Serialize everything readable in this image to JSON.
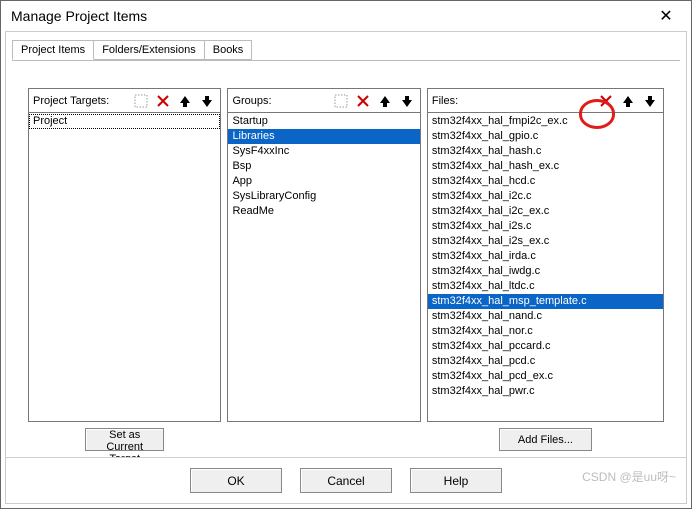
{
  "window": {
    "title": "Manage Project Items"
  },
  "tabs": [
    {
      "label": "Project Items",
      "active": true
    },
    {
      "label": "Folders/Extensions",
      "active": false
    },
    {
      "label": "Books",
      "active": false
    }
  ],
  "columns": {
    "targets": {
      "label": "Project Targets:",
      "items": [
        {
          "label": "Project",
          "selected": false,
          "focus": true
        }
      ],
      "button": "Set as Current Target",
      "icons": [
        "new-icon",
        "delete-icon",
        "move-up-icon",
        "move-down-icon"
      ]
    },
    "groups": {
      "label": "Groups:",
      "items": [
        {
          "label": "Startup",
          "selected": false
        },
        {
          "label": "Libraries",
          "selected": true
        },
        {
          "label": "SysF4xxInc",
          "selected": false
        },
        {
          "label": "Bsp",
          "selected": false
        },
        {
          "label": "App",
          "selected": false
        },
        {
          "label": "SysLibraryConfig",
          "selected": false
        },
        {
          "label": "ReadMe",
          "selected": false
        }
      ],
      "icons": [
        "new-icon",
        "delete-icon",
        "move-up-icon",
        "move-down-icon"
      ]
    },
    "files": {
      "label": "Files:",
      "items": [
        {
          "label": "stm32f4xx_hal_fmpi2c_ex.c",
          "selected": false
        },
        {
          "label": "stm32f4xx_hal_gpio.c",
          "selected": false
        },
        {
          "label": "stm32f4xx_hal_hash.c",
          "selected": false
        },
        {
          "label": "stm32f4xx_hal_hash_ex.c",
          "selected": false
        },
        {
          "label": "stm32f4xx_hal_hcd.c",
          "selected": false
        },
        {
          "label": "stm32f4xx_hal_i2c.c",
          "selected": false
        },
        {
          "label": "stm32f4xx_hal_i2c_ex.c",
          "selected": false
        },
        {
          "label": "stm32f4xx_hal_i2s.c",
          "selected": false
        },
        {
          "label": "stm32f4xx_hal_i2s_ex.c",
          "selected": false
        },
        {
          "label": "stm32f4xx_hal_irda.c",
          "selected": false
        },
        {
          "label": "stm32f4xx_hal_iwdg.c",
          "selected": false
        },
        {
          "label": "stm32f4xx_hal_ltdc.c",
          "selected": false
        },
        {
          "label": "stm32f4xx_hal_msp_template.c",
          "selected": true
        },
        {
          "label": "stm32f4xx_hal_nand.c",
          "selected": false
        },
        {
          "label": "stm32f4xx_hal_nor.c",
          "selected": false
        },
        {
          "label": "stm32f4xx_hal_pccard.c",
          "selected": false
        },
        {
          "label": "stm32f4xx_hal_pcd.c",
          "selected": false
        },
        {
          "label": "stm32f4xx_hal_pcd_ex.c",
          "selected": false
        },
        {
          "label": "stm32f4xx_hal_pwr.c",
          "selected": false
        }
      ],
      "button": "Add Files...",
      "icons": [
        "delete-icon",
        "move-up-icon",
        "move-down-icon"
      ]
    }
  },
  "footer": {
    "ok": "OK",
    "cancel": "Cancel",
    "help": "Help"
  },
  "watermark": "CSDN @是uu呀~"
}
